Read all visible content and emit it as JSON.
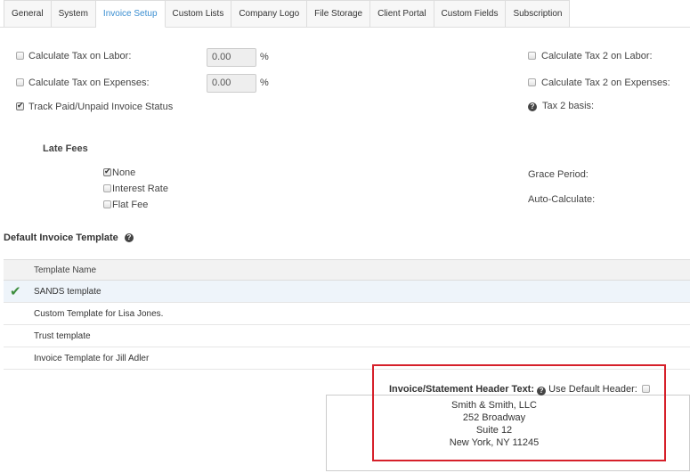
{
  "tabs": [
    {
      "label": "General",
      "active": false
    },
    {
      "label": "System",
      "active": false
    },
    {
      "label": "Invoice Setup",
      "active": true
    },
    {
      "label": "Custom Lists",
      "active": false
    },
    {
      "label": "Company Logo",
      "active": false
    },
    {
      "label": "File Storage",
      "active": false
    },
    {
      "label": "Client Portal",
      "active": false
    },
    {
      "label": "Custom Fields",
      "active": false
    },
    {
      "label": "Subscription",
      "active": false
    }
  ],
  "tax": {
    "labor_label": "Calculate Tax on Labor:",
    "labor_checked": false,
    "labor_value": "0.00",
    "expenses_label": "Calculate Tax on Expenses:",
    "expenses_checked": false,
    "expenses_value": "0.00",
    "percent_sign": "%",
    "track_label": "Track Paid/Unpaid Invoice Status",
    "track_checked": true,
    "tax2_labor_label": "Calculate Tax 2 on Labor:",
    "tax2_expenses_label": "Calculate Tax 2 on Expenses:",
    "tax2_basis_label": "Tax 2 basis:"
  },
  "late_fees": {
    "title": "Late Fees",
    "options": [
      {
        "label": "None",
        "checked": true
      },
      {
        "label": "Interest Rate",
        "checked": false
      },
      {
        "label": "Flat Fee",
        "checked": false
      }
    ],
    "grace_period_label": "Grace Period:",
    "auto_calculate_label": "Auto-Calculate:"
  },
  "default_template": {
    "title": "Default Invoice Template",
    "column_header": "Template Name",
    "rows": [
      {
        "name": "SANDS template",
        "selected": true
      },
      {
        "name": "Custom Template for Lisa Jones.",
        "selected": false
      },
      {
        "name": "Trust template",
        "selected": false
      },
      {
        "name": "Invoice Template for Jill Adler",
        "selected": false
      }
    ]
  },
  "header_text": {
    "label": "Invoice/Statement Header Text:",
    "use_default_label": "Use Default Header:",
    "lines": [
      "Smith & Smith, LLC",
      "252 Broadway",
      "Suite 12",
      "New York, NY 11245"
    ]
  },
  "colors": {
    "accent": "#3a8ed1",
    "highlight_border": "#d6202a",
    "check_green": "#3e8e3e"
  }
}
